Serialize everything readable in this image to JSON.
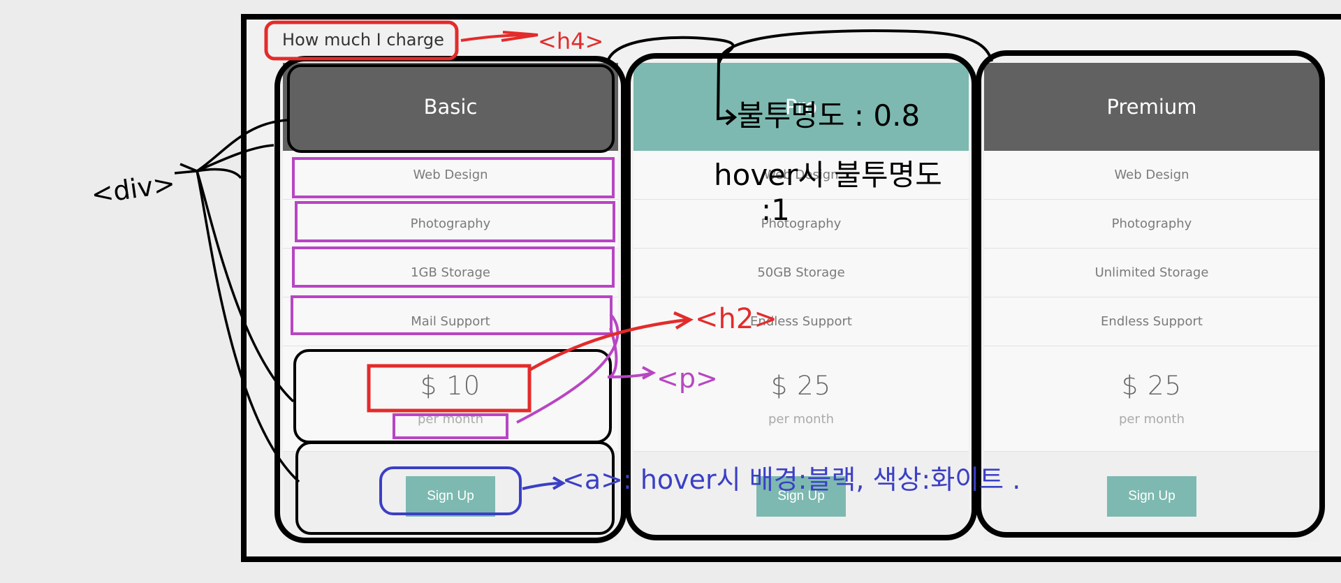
{
  "page": {
    "title": "How much I charge"
  },
  "plans": [
    {
      "name": "Basic",
      "header_color": "#616161",
      "features": [
        "Web Design",
        "Photography",
        "1GB Storage",
        "Mail Support"
      ],
      "price": "$ 10",
      "per": "per month",
      "button": "Sign Up"
    },
    {
      "name": "Pro",
      "header_color": "#7db9b0",
      "features": [
        "Web Design",
        "Photography",
        "50GB Storage",
        "Endless Support"
      ],
      "price": "$ 25",
      "per": "per month",
      "button": "Sign Up"
    },
    {
      "name": "Premium",
      "header_color": "#616161",
      "features": [
        "Web Design",
        "Photography",
        "Unlimited Storage",
        "Endless Support"
      ],
      "price": "$ 25",
      "per": "per month",
      "button": "Sign Up"
    }
  ],
  "annotations": {
    "h4": "<h4>",
    "div": "<div>",
    "h2": "<h2>",
    "p": "<p>",
    "opacity_note": "불투명도 : 0.8",
    "hover_note_1": "hover시 불투명도",
    "hover_note_2": ":1",
    "a_note": "<a>: hover시 배경:블랙, 색상:화이트 ."
  },
  "colors": {
    "accent": "#7db9b0",
    "header_dark": "#616161",
    "annotation_red": "#e32b2b",
    "annotation_purple": "#b845c3",
    "annotation_blue": "#3b3fc5"
  }
}
